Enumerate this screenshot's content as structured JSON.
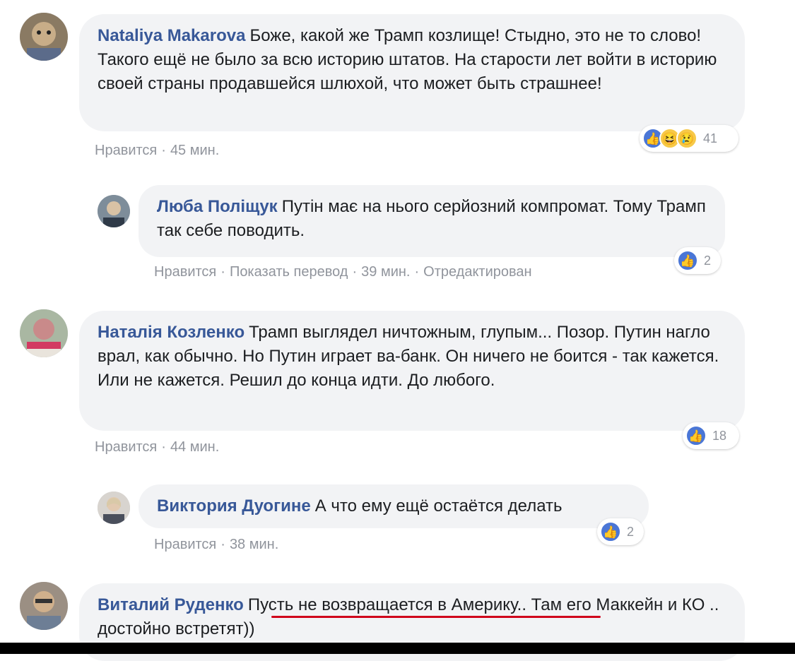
{
  "comments": [
    {
      "author": "Nataliya Makarova",
      "text": "Боже, какой же Трамп козлище! Стыдно, это не то слово! Такого ещё не было за всю историю штатов. На старости лет войти в историю своей страны продавшейся шлюхой, что может быть страшнее!",
      "like": "Нравится",
      "time": "45 мин.",
      "reaction_count": "41",
      "reaction_icons": [
        "like-icon",
        "haha-icon",
        "sad-icon"
      ]
    },
    {
      "author": "Люба Поліщук",
      "text": "Путін має на нього серйозний компромат. Тому Трамп так себе поводить.",
      "like": "Нравится",
      "translate": "Показать перевод",
      "time": "39 мин.",
      "edited": "Отредактирован",
      "reaction_count": "2",
      "reaction_icons": [
        "like-icon"
      ]
    },
    {
      "author": "Наталія Козленко",
      "text": "Трамп выглядел ничтожным, глупым... Позор. Путин нагло врал, как обычно. Но Путин играет ва-банк. Он ничего не боится - так кажется. Или не кажется. Решил до конца идти. До любого.",
      "like": "Нравится",
      "time": "44 мин.",
      "reaction_count": "18",
      "reaction_icons": [
        "like-icon"
      ]
    },
    {
      "author": "Виктория Дуогине",
      "text": "А что ему ещё остаётся делать",
      "like": "Нравится",
      "time": "38 мин.",
      "reaction_count": "2",
      "reaction_icons": [
        "like-icon"
      ]
    },
    {
      "author": "Виталий Руденко",
      "text_highlight": "Пусть не возвращается в Америку..",
      "text_rest": " Там его Маккейн и КО .. достойно встретят))"
    }
  ],
  "colors": {
    "author": "#385898",
    "bubble": "#f2f3f5",
    "meta": "#90949c",
    "like": "#4a76d6",
    "underline": "#d0021b"
  }
}
